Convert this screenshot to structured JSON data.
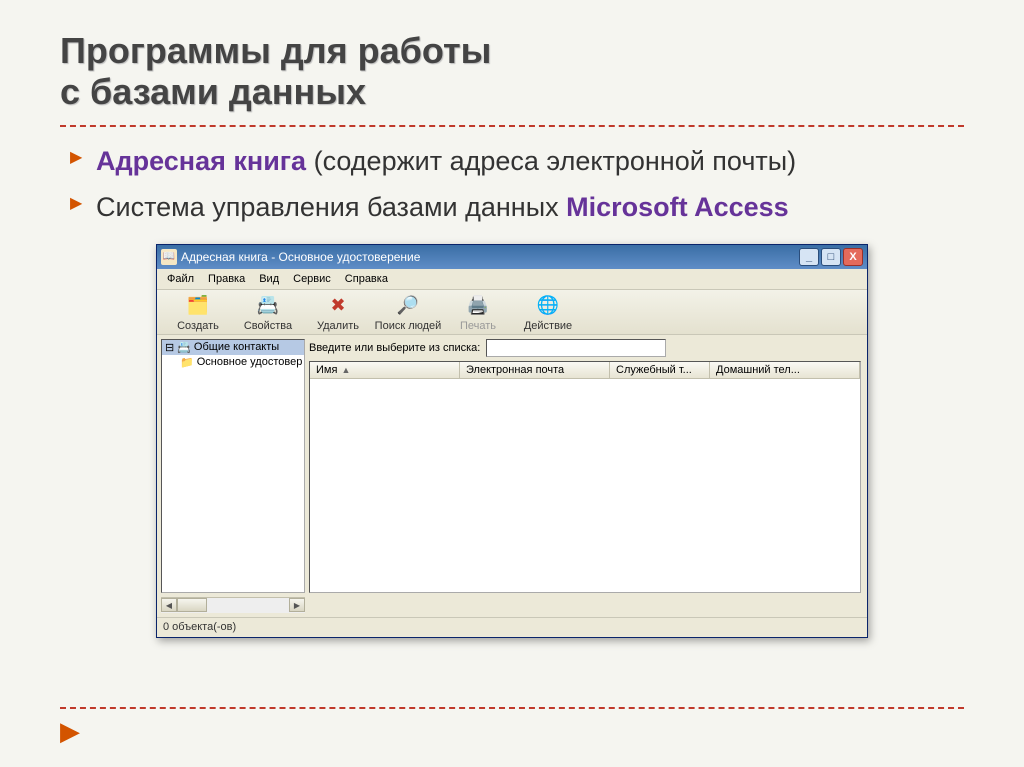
{
  "slide": {
    "title_line1": "Программы для работы",
    "title_line2": "с базами данных",
    "bullet1_strong": "Адресная книга",
    "bullet1_rest": " (содержит адреса электронной почты)",
    "bullet2_pre": "Система управления базами данных ",
    "bullet2_strong": "Microsoft Access"
  },
  "window": {
    "title": "Адресная книга - Основное удостоверение",
    "minimize": "_",
    "maximize": "□",
    "close": "X",
    "menu": {
      "file": "Файл",
      "edit": "Правка",
      "view": "Вид",
      "service": "Сервис",
      "help": "Справка"
    },
    "toolbar": {
      "create": "Создать",
      "properties": "Свойства",
      "delete": "Удалить",
      "find": "Поиск людей",
      "print": "Печать",
      "action": "Действие"
    },
    "tree": {
      "item1": "Общие контакты",
      "item2": "Основное удостовер"
    },
    "search_label": "Введите или выберите из списка:",
    "search_value": "",
    "columns": {
      "name": "Имя",
      "email": "Электронная почта",
      "work_phone": "Служебный т...",
      "home_phone": "Домашний тел..."
    },
    "scroll_left": "◀",
    "scroll_right": "▶",
    "statusbar": "0 объекта(-ов)"
  }
}
